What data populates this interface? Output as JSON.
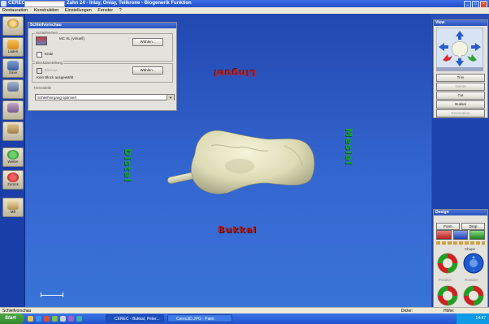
{
  "window": {
    "app_name": "CEREC",
    "document_title": "Zahn 24 - Inlay, Onlay, Teilkrone - Biogenerik Funktion"
  },
  "menu": [
    "Restauration",
    "Konstruktion",
    "Einstellungen",
    "Fenster",
    "?"
  ],
  "left_toolbar": [
    {
      "label": "",
      "icon": "logo-icon"
    },
    {
      "label": "Laden",
      "icon": "folder-open-icon"
    },
    {
      "label": "Save",
      "icon": "save-icon"
    },
    {
      "label": "",
      "icon": "scan-icon"
    },
    {
      "label": "",
      "icon": "model-icon"
    },
    {
      "label": "",
      "icon": "tooth-icon"
    },
    {
      "label": "Weiter",
      "icon": "forward-arrow-icon"
    },
    {
      "label": "Zurück",
      "icon": "back-arrow-icon"
    },
    {
      "label": "Mill",
      "icon": "mill-icon"
    }
  ],
  "grind_panel": {
    "title": "Schleifvorschau",
    "unit_group_label": "Schleifeinheit",
    "unit_value": "MC XL (virtuell)",
    "unit_button": "Wählen...",
    "checkbox_label": "Ende",
    "block_group_label": "Blockdarstellung",
    "block_checkbox_label": "Ein/Aus",
    "block_value": "Kein Block ausgewählt",
    "block_button": "Wählen...",
    "separator_label": "Trennstelle",
    "process_select": "Schleifvorgang optimiert"
  },
  "viewport": {
    "labels": {
      "lingual": "Lingual",
      "bukkal": "Bukkal",
      "distal": "Distal",
      "mesial": "Mesial"
    }
  },
  "view_panel": {
    "title": "View",
    "buttons": [
      "Trim",
      "Delete",
      "Cut",
      "Bukkal",
      "Restoration"
    ],
    "disabled": [
      false,
      true,
      false,
      false,
      true
    ]
  },
  "design_panel": {
    "title": "Design",
    "row1": [
      "Form",
      "Drop"
    ],
    "tools_label": "Shape",
    "bottom_labels": [
      "Position",
      "Rotation"
    ]
  },
  "status": {
    "left": "Schleifvorschau",
    "middle": "Dicke:",
    "right": "Höhe:"
  },
  "taskbar": {
    "start": "Start",
    "tasks": [
      "CEREC - Bukkal, Peter...",
      "Cerec3D.JPG - Paint"
    ],
    "time": "14:47"
  },
  "colors": {
    "viewport_top": "#2247b0",
    "viewport_bottom": "#3a74d8",
    "label_red": "#c02020",
    "label_green": "#18a040",
    "tooth": "#e8e6c8"
  }
}
